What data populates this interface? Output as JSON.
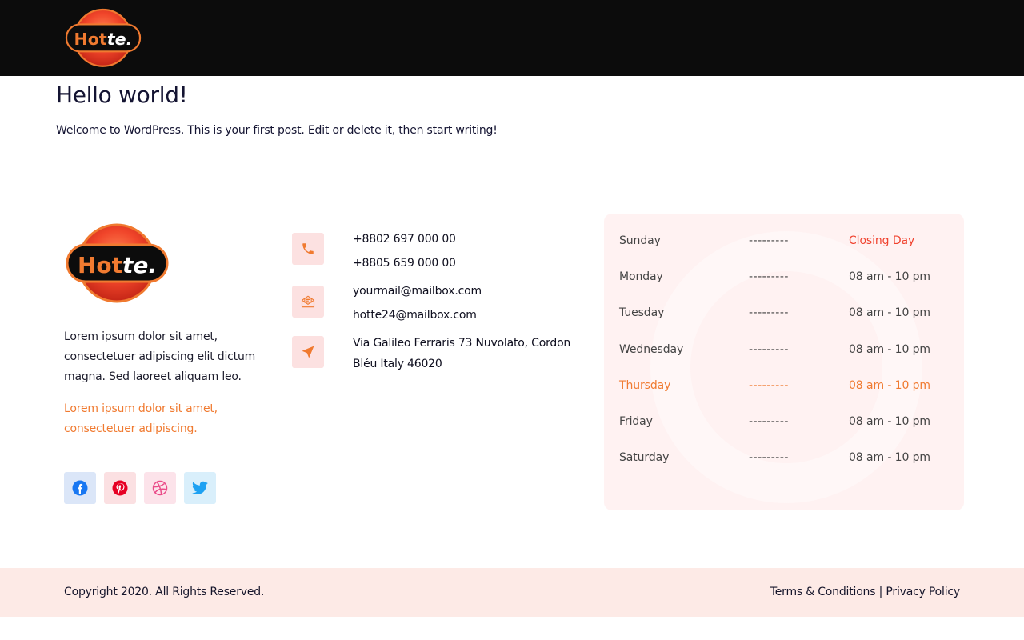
{
  "brand": {
    "logo_text": "Hotte.",
    "accent": "#f07a30",
    "dark": "#0c0c0c"
  },
  "post": {
    "title": "Hello world!",
    "body": "Welcome to WordPress. This is your first post. Edit or delete it, then start writing!"
  },
  "footer_about": {
    "text": "Lorem ipsum dolor sit amet, consectetuer adipiscing elit dictum magna. Sed laoreet aliquam leo.",
    "accent_text": "Lorem ipsum dolor sit amet, consectetuer adipiscing."
  },
  "social": [
    {
      "name": "facebook",
      "icon": "facebook-icon",
      "color": "#1877f2"
    },
    {
      "name": "pinterest",
      "icon": "pinterest-icon",
      "color": "#e60023"
    },
    {
      "name": "dribbble",
      "icon": "dribbble-icon",
      "color": "#ea4c89"
    },
    {
      "name": "twitter",
      "icon": "twitter-icon",
      "color": "#1da1f2"
    }
  ],
  "contact": {
    "phone_icon": "phone-icon",
    "mail_icon": "envelope-icon",
    "location_icon": "navigation-arrow-icon",
    "phones": [
      "+8802 697 000 00",
      "+8805 659 000 00"
    ],
    "emails": [
      "yourmail@mailbox.com",
      "hotte24@mailbox.com"
    ],
    "address_lines": [
      "Via Galileo Ferraris 73 Nuvolato, Cordon",
      "Bléu Italy 46020"
    ]
  },
  "hours": [
    {
      "day": "Sunday",
      "dashes": "---------",
      "time": "Closing Day",
      "state": "closed"
    },
    {
      "day": "Monday",
      "dashes": "---------",
      "time": "08 am - 10 pm",
      "state": "normal"
    },
    {
      "day": "Tuesday",
      "dashes": "---------",
      "time": "08 am - 10 pm",
      "state": "normal"
    },
    {
      "day": "Wednesday",
      "dashes": "---------",
      "time": "08 am - 10 pm",
      "state": "normal"
    },
    {
      "day": "Thursday",
      "dashes": "---------",
      "time": "08 am - 10 pm",
      "state": "active"
    },
    {
      "day": "Friday",
      "dashes": "---------",
      "time": "08 am - 10 pm",
      "state": "normal"
    },
    {
      "day": "Saturday",
      "dashes": "---------",
      "time": "08 am - 10 pm",
      "state": "normal"
    }
  ],
  "bottom_bar": {
    "copyright": "Copyright 2020. All Rights Reserved.",
    "terms": "Terms & Conditions",
    "separator": "|",
    "privacy": "Privacy Policy"
  }
}
